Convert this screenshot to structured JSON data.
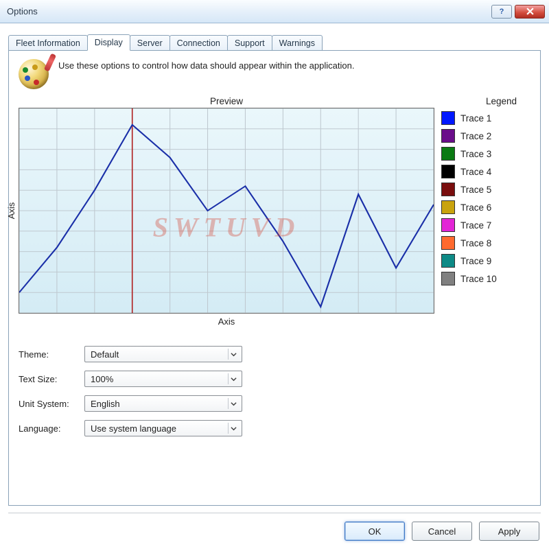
{
  "window": {
    "title": "Options"
  },
  "tabs": [
    {
      "label": "Fleet Information"
    },
    {
      "label": "Display"
    },
    {
      "label": "Server"
    },
    {
      "label": "Connection"
    },
    {
      "label": "Support"
    },
    {
      "label": "Warnings"
    }
  ],
  "description": "Use these options to control how data should appear within the application.",
  "preview": {
    "title": "Preview",
    "legend_title": "Legend",
    "x_axis": "Axis",
    "y_axis": "Axis",
    "watermark": "SWTUVD"
  },
  "legend": [
    {
      "label": "Trace 1",
      "color": "#0018ff"
    },
    {
      "label": "Trace 2",
      "color": "#6a0d8a"
    },
    {
      "label": "Trace 3",
      "color": "#0a7a12"
    },
    {
      "label": "Trace 4",
      "color": "#000000"
    },
    {
      "label": "Trace 5",
      "color": "#7a0e0e"
    },
    {
      "label": "Trace 6",
      "color": "#c9a30e"
    },
    {
      "label": "Trace 7",
      "color": "#e325d6"
    },
    {
      "label": "Trace 8",
      "color": "#ff6a2f"
    },
    {
      "label": "Trace 9",
      "color": "#0e8a86"
    },
    {
      "label": "Trace 10",
      "color": "#808080"
    }
  ],
  "form": {
    "theme": {
      "label": "Theme:",
      "value": "Default"
    },
    "text_size": {
      "label": "Text Size:",
      "value": "100%"
    },
    "unit_system": {
      "label": "Unit System:",
      "value": "English"
    },
    "language": {
      "label": "Language:",
      "value": "Use system language"
    }
  },
  "buttons": {
    "ok": "OK",
    "cancel": "Cancel",
    "apply": "Apply"
  },
  "chart_data": {
    "type": "line",
    "title": "Preview",
    "xlabel": "Axis",
    "ylabel": "Axis",
    "xlim": [
      0,
      11
    ],
    "ylim": [
      0,
      10
    ],
    "marker_x": 3.0,
    "series": [
      {
        "name": "Trace 1",
        "color": "#1a2fa8",
        "x": [
          0,
          1,
          2,
          3,
          4,
          5,
          6,
          7,
          8,
          9,
          10,
          11
        ],
        "values": [
          1.0,
          3.2,
          6.0,
          9.2,
          7.6,
          5.0,
          6.2,
          3.5,
          0.3,
          5.8,
          2.2,
          5.3
        ]
      }
    ]
  }
}
